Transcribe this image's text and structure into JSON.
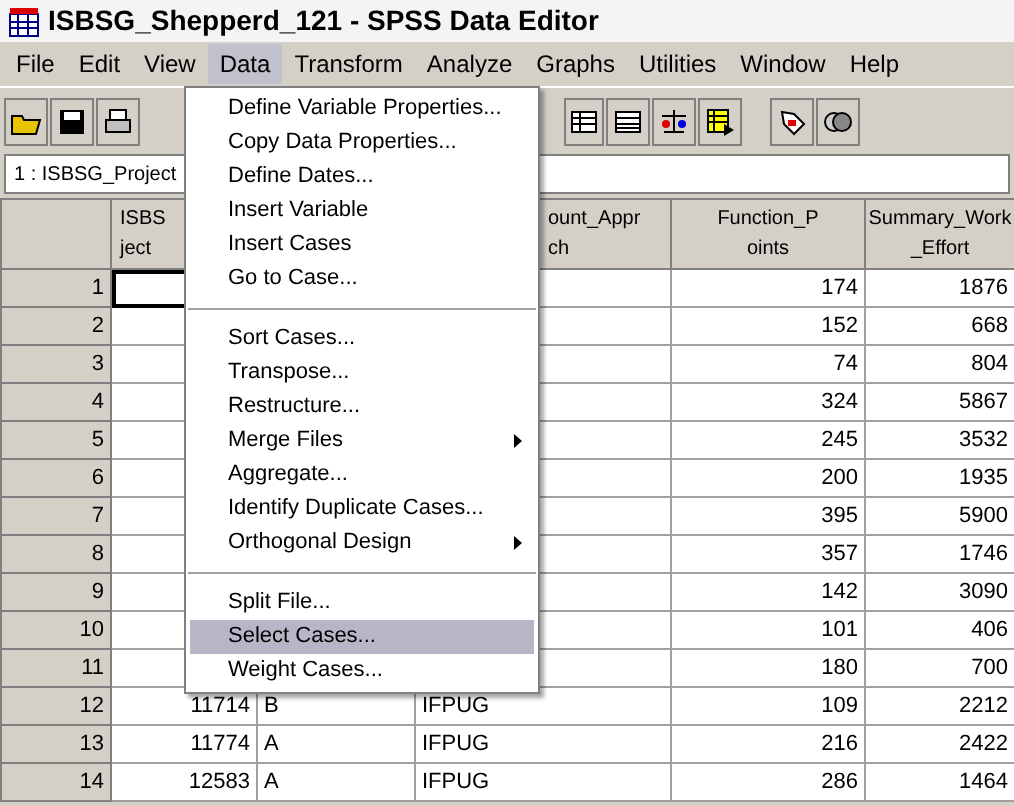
{
  "window": {
    "title": "ISBSG_Shepperd_121 - SPSS Data Editor"
  },
  "menu_bar": [
    {
      "label": "File",
      "selected": false
    },
    {
      "label": "Edit",
      "selected": false
    },
    {
      "label": "View",
      "selected": false
    },
    {
      "label": "Data",
      "selected": true
    },
    {
      "label": "Transform",
      "selected": false
    },
    {
      "label": "Analyze",
      "selected": false
    },
    {
      "label": "Graphs",
      "selected": false
    },
    {
      "label": "Utilities",
      "selected": false
    },
    {
      "label": "Window",
      "selected": false
    },
    {
      "label": "Help",
      "selected": false
    }
  ],
  "cell_editor": {
    "value": "1 : ISBSG_Project"
  },
  "table": {
    "columns": [
      {
        "lines": [
          "ISBS",
          "ject"
        ]
      },
      {},
      {
        "lines": [
          "ount_Appr",
          "ch"
        ]
      },
      {
        "lines": [
          "Function_P",
          "oints"
        ]
      },
      {
        "lines": [
          "Summary_Work",
          "_Effort"
        ]
      }
    ],
    "rows": [
      {
        "case": "1",
        "selected": true,
        "cells": [
          "",
          "",
          "",
          "174",
          "1876"
        ]
      },
      {
        "case": "2",
        "selected": false,
        "cells": [
          "",
          "",
          "",
          "152",
          "668"
        ]
      },
      {
        "case": "3",
        "selected": false,
        "cells": [
          "",
          "",
          "",
          "74",
          "804"
        ]
      },
      {
        "case": "4",
        "selected": false,
        "cells": [
          "",
          "",
          "",
          "324",
          "5867"
        ]
      },
      {
        "case": "5",
        "selected": false,
        "cells": [
          "",
          "",
          "",
          "245",
          "3532"
        ]
      },
      {
        "case": "6",
        "selected": false,
        "cells": [
          "",
          "",
          "",
          "200",
          "1935"
        ]
      },
      {
        "case": "7",
        "selected": false,
        "cells": [
          "",
          "",
          "",
          "395",
          "5900"
        ]
      },
      {
        "case": "8",
        "selected": false,
        "cells": [
          "",
          "",
          "",
          "357",
          "1746"
        ]
      },
      {
        "case": "9",
        "selected": false,
        "cells": [
          "",
          "",
          "",
          "142",
          "3090"
        ]
      },
      {
        "case": "10",
        "selected": false,
        "cells": [
          "",
          "",
          "",
          "101",
          "406"
        ]
      },
      {
        "case": "11",
        "selected": false,
        "cells": [
          "",
          "",
          "",
          "180",
          "700"
        ]
      },
      {
        "case": "12",
        "selected": false,
        "cells": [
          "11714",
          "B",
          "IFPUG",
          "109",
          "2212"
        ]
      },
      {
        "case": "13",
        "selected": false,
        "cells": [
          "11774",
          "A",
          "IFPUG",
          "216",
          "2422"
        ]
      },
      {
        "case": "14",
        "selected": false,
        "cells": [
          "12583",
          "A",
          "IFPUG",
          "286",
          "1464"
        ]
      }
    ]
  },
  "data_menu": {
    "groups": [
      [
        {
          "label": "Define Variable Properties...",
          "selected": false,
          "submenu": false
        },
        {
          "label": "Copy Data Properties...",
          "selected": false,
          "submenu": false
        },
        {
          "label": "Define Dates...",
          "selected": false,
          "submenu": false
        },
        {
          "label": "Insert Variable",
          "selected": false,
          "submenu": false
        },
        {
          "label": "Insert Cases",
          "selected": false,
          "submenu": false
        },
        {
          "label": "Go to Case...",
          "selected": false,
          "submenu": false
        }
      ],
      [
        {
          "label": "Sort Cases...",
          "selected": false,
          "submenu": false
        },
        {
          "label": "Transpose...",
          "selected": false,
          "submenu": false
        },
        {
          "label": "Restructure...",
          "selected": false,
          "submenu": false
        },
        {
          "label": "Merge Files",
          "selected": false,
          "submenu": true
        },
        {
          "label": "Aggregate...",
          "selected": false,
          "submenu": false
        },
        {
          "label": "Identify Duplicate Cases...",
          "selected": false,
          "submenu": false
        },
        {
          "label": "Orthogonal Design",
          "selected": false,
          "submenu": true
        }
      ],
      [
        {
          "label": "Split File...",
          "selected": false,
          "submenu": false
        },
        {
          "label": "Select Cases...",
          "selected": true,
          "submenu": false
        },
        {
          "label": "Weight Cases...",
          "selected": false,
          "submenu": false
        }
      ]
    ]
  }
}
